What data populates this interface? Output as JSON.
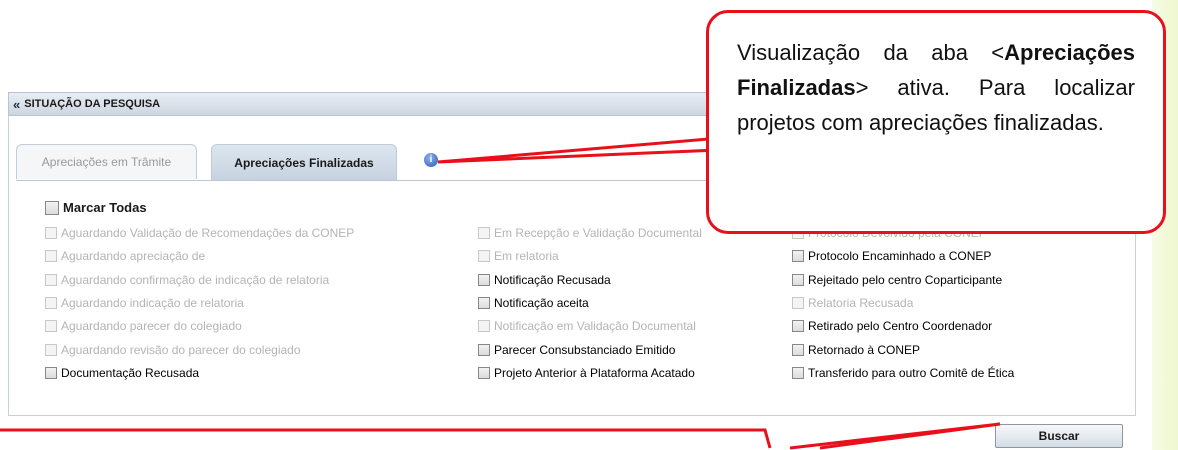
{
  "panel": {
    "title": "SITUAÇÃO DA PESQUISA",
    "chevron": "«"
  },
  "tabs": [
    {
      "label": "Apreciações em Trâmite",
      "active": false
    },
    {
      "label": "Apreciações Finalizadas",
      "active": true
    }
  ],
  "info_icon": {
    "icon": "info-icon",
    "glyph": "i"
  },
  "select_all": {
    "label": "Marcar Todas"
  },
  "columns": {
    "left": [
      {
        "label": "Aguardando Validação de Recomendações da CONEP",
        "enabled": false
      },
      {
        "label": "Aguardando apreciação de",
        "enabled": false
      },
      {
        "label": "Aguardando confirmação de indicação de relatoria",
        "enabled": false
      },
      {
        "label": "Aguardando indicação de relatoria",
        "enabled": false
      },
      {
        "label": "Aguardando parecer do colegiado",
        "enabled": false
      },
      {
        "label": "Aguardando revisão do parecer do colegiado",
        "enabled": false
      },
      {
        "label": "Documentação Recusada",
        "enabled": true
      }
    ],
    "middle": [
      {
        "label": "Em Recepção e Validação Documental",
        "enabled": false
      },
      {
        "label": "Em relatoria",
        "enabled": false
      },
      {
        "label": "Notificação Recusada",
        "enabled": true
      },
      {
        "label": "Notificação aceita",
        "enabled": true
      },
      {
        "label": "Notificação em Validação Documental",
        "enabled": false
      },
      {
        "label": "Parecer Consubstanciado Emitido",
        "enabled": true
      },
      {
        "label": "Projeto Anterior à Plataforma Acatado",
        "enabled": true
      }
    ],
    "right": [
      {
        "label": "Protocolo Devolvido pela CONEP",
        "enabled": false
      },
      {
        "label": "Protocolo Encaminhado a CONEP",
        "enabled": true
      },
      {
        "label": "Rejeitado pelo centro Coparticipante",
        "enabled": true
      },
      {
        "label": "Relatoria Recusada",
        "enabled": false
      },
      {
        "label": "Retirado pelo Centro Coordenador",
        "enabled": true
      },
      {
        "label": "Retornado à CONEP",
        "enabled": true
      },
      {
        "label": "Transferido para outro Comitê de Ética",
        "enabled": true
      }
    ]
  },
  "buscar_label": "Buscar",
  "callout": {
    "prefix": "Visualização da aba <",
    "bold": "Apreciações Finalizadas",
    "suffix": "> ativa. Para localizar projetos com apreciações finalizadas."
  },
  "colors": {
    "callout_red": "#e8101a",
    "active_tab": "#c6d3e0"
  }
}
